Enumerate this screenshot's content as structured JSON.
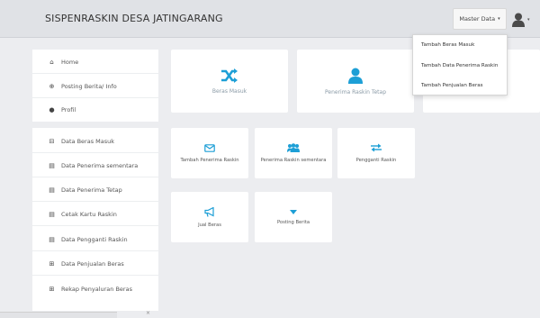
{
  "navbar": {
    "brand": "SISPENRASKIN DESA JATINGARANG",
    "master_data_label": "Master Data",
    "master_data_caret": "▾",
    "user_caret": "▾"
  },
  "dropdown": {
    "items": [
      {
        "label": "Tambah Beras Masuk"
      },
      {
        "label": "Tambah Data Penerima Raskin"
      },
      {
        "label": "Tambah Penjualan Beras"
      }
    ]
  },
  "sidebar": {
    "top_items": [
      {
        "label": "Home",
        "icon": "home-icon"
      },
      {
        "label": "Posting Berita/ Info",
        "icon": "globe-icon"
      },
      {
        "label": "Profil",
        "icon": "user-icon"
      }
    ],
    "bottom_items": [
      {
        "label": "Data Beras Masuk",
        "icon": "inbox-icon"
      },
      {
        "label": "Data Penerima sementara",
        "icon": "list-icon"
      },
      {
        "label": "Data Penerima Tetap",
        "icon": "list-icon"
      },
      {
        "label": "Cetak Kartu Raskin",
        "icon": "list-icon"
      },
      {
        "label": "Data Pengganti Raskin",
        "icon": "list-icon"
      },
      {
        "label": "Data Penjualan Beras",
        "icon": "table-icon"
      },
      {
        "label": "Rekap Penyaluran Beras",
        "icon": "table-icon"
      }
    ]
  },
  "tiles_large": [
    {
      "label": "Beras Masuk",
      "icon": "shuffle-icon"
    },
    {
      "label": "Penerima Raskin Tetap",
      "icon": "person-icon"
    },
    {
      "label": "",
      "icon": ""
    }
  ],
  "tiles_row2": [
    {
      "label": "Tambah Penerima Raskin",
      "icon": "envelope-icon"
    },
    {
      "label": "Penerima Raskin sementara",
      "icon": "users-icon"
    },
    {
      "label": "Pengganti Raskin",
      "icon": "exchange-icon"
    }
  ],
  "tiles_row3": [
    {
      "label": "Jual Beras",
      "icon": "bullhorn-icon"
    },
    {
      "label": "Posting Berita",
      "icon": "caret-down-icon"
    }
  ],
  "colors": {
    "accent": "#1d9fd6",
    "navbar_bg": "#e0e2e6",
    "page_bg": "#ecedf0"
  }
}
